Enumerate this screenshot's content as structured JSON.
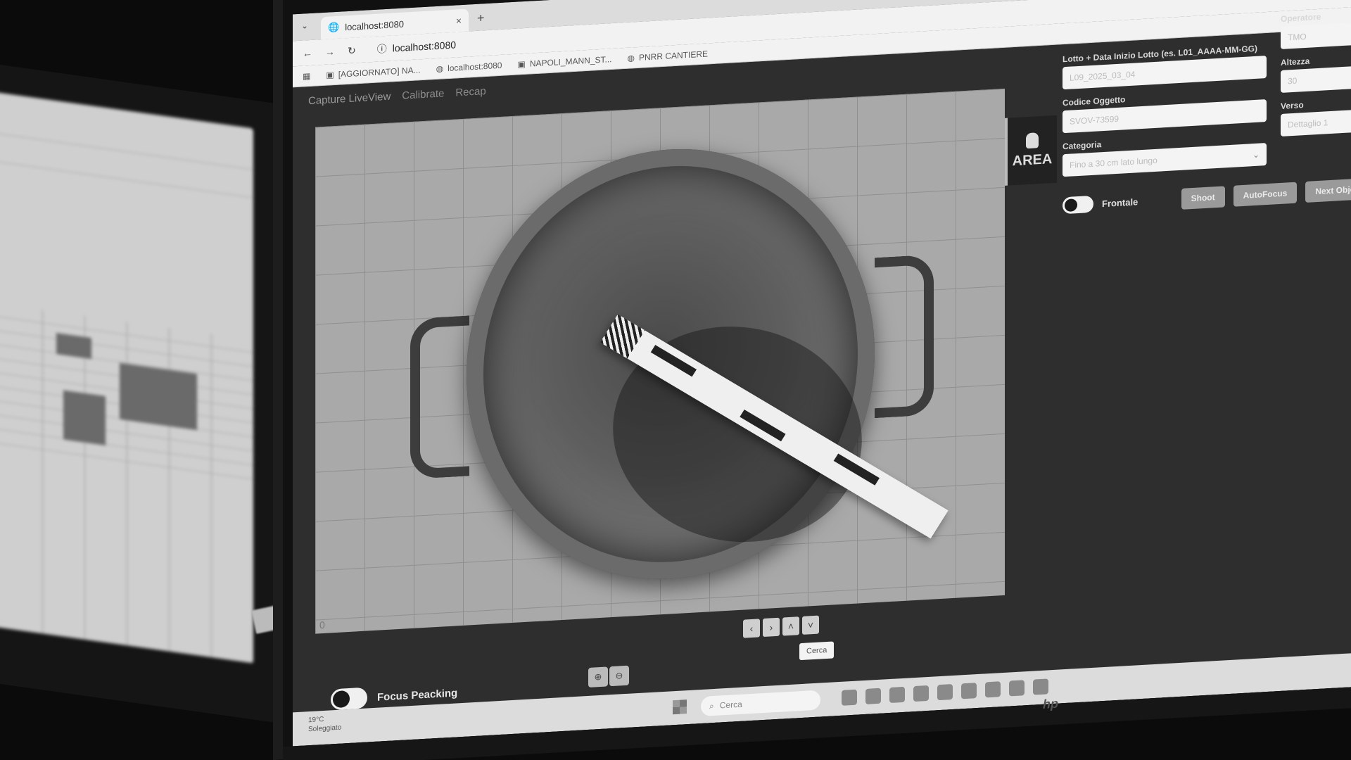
{
  "browser": {
    "tab_title": "localhost:8080",
    "tab_close": "×",
    "new_tab": "+",
    "tab_menu": "⌄",
    "address": "localhost:8080",
    "bookmarks": [
      "[AGGIORNATO] NA...",
      "localhost:8080",
      "NAPOLI_MANN_ST...",
      "PNRR CANTIERE"
    ]
  },
  "nav": {
    "items": [
      "Capture LiveView",
      "Calibrate",
      "Recap"
    ]
  },
  "liveview": {
    "corner_label": "0",
    "area_label": "AREA"
  },
  "form": {
    "lotto_label": "Lotto + Data Inizio Lotto (es. L01_AAAA-MM-GG)",
    "lotto_value": "L09_2025_03_04",
    "codice_label": "Codice Oggetto",
    "codice_value": "SVOV-73599",
    "categoria_label": "Categoria",
    "categoria_value": "Fino a 30 cm lato lungo",
    "operatore_label": "Operatore",
    "operatore_value": "TMO",
    "altezza_label": "Altezza",
    "altezza_value": "30",
    "verso_label": "Verso",
    "verso_value": "Dettaglio 1",
    "frontale_label": "Frontale",
    "shoot_label": "Shoot",
    "autofocus_label": "AutoFocus",
    "next_label": "Next Object"
  },
  "controls": {
    "arrows": [
      "‹",
      "›",
      "˄",
      "˅"
    ],
    "cerca_label": "Cerca",
    "zoom_in": "⊕",
    "zoom_out": "⊖",
    "focus_label": "Focus Peacking"
  },
  "taskbar": {
    "weather_temp": "19°C",
    "weather_desc": "Soleggiato",
    "search_placeholder": "Cerca"
  },
  "monitor_brand": "hp"
}
